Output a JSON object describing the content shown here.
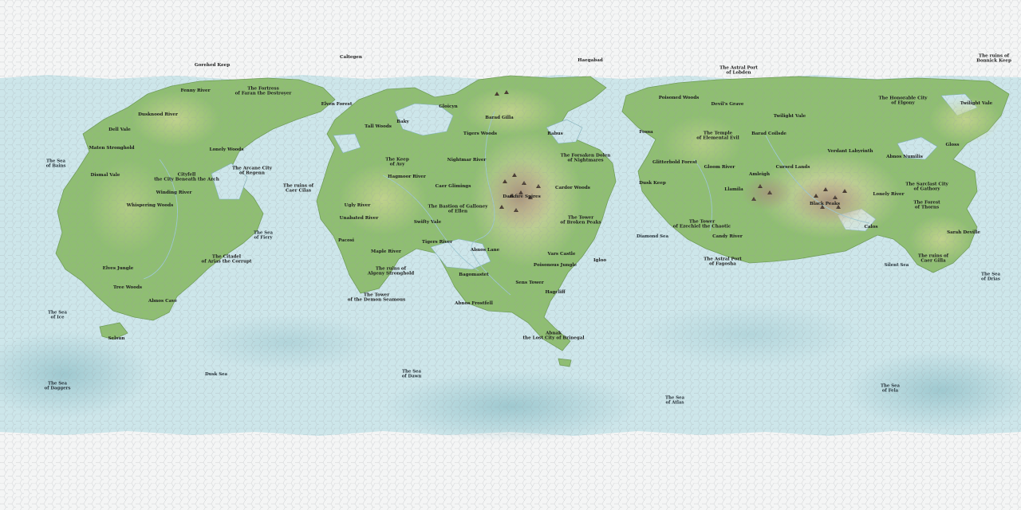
{
  "map": {
    "colors": {
      "ice": "#f4f5f5",
      "ocean": "#cde6ea",
      "deep_ocean": "#8fbfc7",
      "lowland": "#8fbe72",
      "plains": "#c8d494",
      "hills": "#e0dcae",
      "mountains": "#a48f78",
      "hex_grid": "#9aa0a3",
      "label": "#1c1c1c"
    },
    "labels": [
      {
        "id": "gorehed-keep",
        "text": "Gorehed Keep",
        "type": "polar"
      },
      {
        "id": "caltegen",
        "text": "Caltegen",
        "type": "polar"
      },
      {
        "id": "haegabad",
        "text": "Haegabad",
        "type": "polar"
      },
      {
        "id": "astral-port-lobden",
        "text": "The Astral Port\nof Lobden",
        "type": "polar"
      },
      {
        "id": "ruins-bonnick-keep",
        "text": "The ruins of\nBonnick Keep",
        "type": "polar"
      },
      {
        "id": "fenny-river",
        "text": "Fenny River",
        "type": "land"
      },
      {
        "id": "fortress-faran",
        "text": "The Fortress\nof Faran the Destroyer",
        "type": "land"
      },
      {
        "id": "elven-forest",
        "text": "Elven Forest",
        "type": "land"
      },
      {
        "id": "dusknood-river",
        "text": "Dusknood River",
        "type": "land"
      },
      {
        "id": "dell-vale",
        "text": "Dell Vale",
        "type": "land"
      },
      {
        "id": "maten-stronghold",
        "text": "Maten Stronghold",
        "type": "land"
      },
      {
        "id": "lonely-woods",
        "text": "Lonely Woods",
        "type": "land"
      },
      {
        "id": "sea-bains",
        "text": "The Sea\nof Bains",
        "type": "sea"
      },
      {
        "id": "dismal-vale",
        "text": "Dismal Vale",
        "type": "land"
      },
      {
        "id": "cityfell",
        "text": "Cityfell\nthe City Beneath the Arch",
        "type": "land"
      },
      {
        "id": "arcane-city-regenn",
        "text": "The Arcane City\nof Regenn",
        "type": "land"
      },
      {
        "id": "winding-river",
        "text": "Winding River",
        "type": "land"
      },
      {
        "id": "whispering-woods",
        "text": "Whispering Woods",
        "type": "land"
      },
      {
        "id": "ruins-caer-cilas",
        "text": "The ruins of\nCaer Cilas",
        "type": "land"
      },
      {
        "id": "sea-fiery",
        "text": "The Sea\nof Fiery",
        "type": "sea"
      },
      {
        "id": "citadel-arias",
        "text": "The Citadel\nof Arias the Corrupt",
        "type": "land"
      },
      {
        "id": "elves-jungle",
        "text": "Elves Jungle",
        "type": "land"
      },
      {
        "id": "tree-woods",
        "text": "Tree Woods",
        "type": "land"
      },
      {
        "id": "abnos-cave",
        "text": "Abnos Cave",
        "type": "land"
      },
      {
        "id": "sea-ice",
        "text": "The Sea\nof Ice",
        "type": "sea"
      },
      {
        "id": "selsun",
        "text": "Selsun",
        "type": "land"
      },
      {
        "id": "dusk-sea",
        "text": "Dusk Sea",
        "type": "sea"
      },
      {
        "id": "sea-daggers",
        "text": "The Sea\nof Daggers",
        "type": "sea"
      },
      {
        "id": "tall-woods",
        "text": "Tall Woods",
        "type": "land"
      },
      {
        "id": "baky",
        "text": "Baky",
        "type": "land"
      },
      {
        "id": "gloicyn",
        "text": "Gloicyn",
        "type": "land"
      },
      {
        "id": "barad-gilla",
        "text": "Barad Gilla",
        "type": "land"
      },
      {
        "id": "tigers-woods",
        "text": "Tigers Woods",
        "type": "land"
      },
      {
        "id": "rabus",
        "text": "Rabus",
        "type": "land"
      },
      {
        "id": "keep-avy",
        "text": "The Keep\nof Avy",
        "type": "land"
      },
      {
        "id": "hagmoor-river",
        "text": "Hagmoor River",
        "type": "land"
      },
      {
        "id": "nightmar-river",
        "text": "Nightmar River",
        "type": "land"
      },
      {
        "id": "forsaken-dolen",
        "text": "The Forsaken Dolen\nof Nightmares",
        "type": "land"
      },
      {
        "id": "caer-glimings",
        "text": "Caer Glimings",
        "type": "land"
      },
      {
        "id": "bastion-galloney",
        "text": "The Bastion of Galloney\nof Ellen",
        "type": "land"
      },
      {
        "id": "cardor-woods",
        "text": "Cardor Woods",
        "type": "land"
      },
      {
        "id": "ugly-river",
        "text": "Ugly River",
        "type": "land"
      },
      {
        "id": "unabated-river",
        "text": "Unabated River",
        "type": "land"
      },
      {
        "id": "swifty-vale",
        "text": "Swifty Vale",
        "type": "land"
      },
      {
        "id": "darkfire-spires",
        "text": "Darkfire Spires",
        "type": "land"
      },
      {
        "id": "tower-broken-peaks",
        "text": "The Tower\nof Broken Peaks",
        "type": "land"
      },
      {
        "id": "pacosi",
        "text": "Pacosi",
        "type": "land"
      },
      {
        "id": "tigers-river",
        "text": "Tigers River",
        "type": "land"
      },
      {
        "id": "abnos-lane",
        "text": "Abnos Lane",
        "type": "land"
      },
      {
        "id": "maple-river",
        "text": "Maple River",
        "type": "land"
      },
      {
        "id": "vars-castle",
        "text": "Vars Castle",
        "type": "land"
      },
      {
        "id": "igloo",
        "text": "Igloo",
        "type": "land"
      },
      {
        "id": "ruins-algeny",
        "text": "The ruins of\nAlgeny Stronghold",
        "type": "land"
      },
      {
        "id": "poisonous-jungle",
        "text": "Poisonous Jungle",
        "type": "land"
      },
      {
        "id": "bagomastet",
        "text": "Bagomastet",
        "type": "land"
      },
      {
        "id": "sens-tower",
        "text": "Sens Tower",
        "type": "land"
      },
      {
        "id": "tower-demon",
        "text": "The Tower\nof the Demon Seamous",
        "type": "land"
      },
      {
        "id": "hagcliff",
        "text": "Hagcliff",
        "type": "land"
      },
      {
        "id": "abnos-frostfell",
        "text": "Abnos Frostfell",
        "type": "land"
      },
      {
        "id": "sea-dawn",
        "text": "The Sea\nof Dawn",
        "type": "sea"
      },
      {
        "id": "abnak",
        "text": "Abnak\nthe Lost City of Brinegal",
        "type": "land"
      },
      {
        "id": "poisoned-woods",
        "text": "Poisoned Woods",
        "type": "land"
      },
      {
        "id": "devils-grave",
        "text": "Devil's Grave",
        "type": "land"
      },
      {
        "id": "twilight-vale",
        "text": "Twilight Vale",
        "type": "land"
      },
      {
        "id": "honorable-city",
        "text": "The Honorable City\nof Elgony",
        "type": "land"
      },
      {
        "id": "twilight-vale-east",
        "text": "Twilight Vale",
        "type": "land"
      },
      {
        "id": "temple-elemental",
        "text": "The Temple\nof Elemental Evil",
        "type": "land"
      },
      {
        "id": "barad-coilsde",
        "text": "Barad Coilsde",
        "type": "land"
      },
      {
        "id": "fossa",
        "text": "Fossa",
        "type": "land"
      },
      {
        "id": "gloss",
        "text": "Gloss",
        "type": "land"
      },
      {
        "id": "verdant-labyrinth",
        "text": "Verdant Labyrinth",
        "type": "land"
      },
      {
        "id": "abnos-numilis",
        "text": "Abnos Numilis",
        "type": "land"
      },
      {
        "id": "glitterbold-forest",
        "text": "Glitterbold Forest",
        "type": "land"
      },
      {
        "id": "gloom-river",
        "text": "Gloom River",
        "type": "land"
      },
      {
        "id": "cursed-lands",
        "text": "Cursed Lands",
        "type": "land"
      },
      {
        "id": "sarclast-city",
        "text": "The Sarclast City\nof Gathory",
        "type": "land"
      },
      {
        "id": "dusk-keep",
        "text": "Dusk Keep",
        "type": "land"
      },
      {
        "id": "amleigh",
        "text": "Amleigh",
        "type": "land"
      },
      {
        "id": "llamila",
        "text": "Llamila",
        "type": "land"
      },
      {
        "id": "lonely-river",
        "text": "Lonely River",
        "type": "land"
      },
      {
        "id": "forest-thorns",
        "text": "The Forest\nof Thorns",
        "type": "land"
      },
      {
        "id": "black-peaks",
        "text": "Black Peaks",
        "type": "land"
      },
      {
        "id": "tower-ezechiel",
        "text": "The Tower\nof Ezechiel the Chaotic",
        "type": "land"
      },
      {
        "id": "calos",
        "text": "Calos",
        "type": "land"
      },
      {
        "id": "sarah-deville",
        "text": "Sarah Deville",
        "type": "land"
      },
      {
        "id": "diamond-sea",
        "text": "Diamond Sea",
        "type": "sea"
      },
      {
        "id": "candy-river",
        "text": "Candy River",
        "type": "land"
      },
      {
        "id": "ruins-caer-gilla",
        "text": "The ruins of\nCaer Gilla",
        "type": "land"
      },
      {
        "id": "astral-port-fagosha",
        "text": "The Astral Port\nof Fagosha",
        "type": "land"
      },
      {
        "id": "silent-sea",
        "text": "Silent Sea",
        "type": "sea"
      },
      {
        "id": "sea-drias",
        "text": "The Sea\nof Drias",
        "type": "sea"
      },
      {
        "id": "sea-atlas",
        "text": "The Sea\nof Atlas",
        "type": "sea"
      },
      {
        "id": "sea-fela",
        "text": "The Sea\nof Fela",
        "type": "sea"
      }
    ]
  }
}
